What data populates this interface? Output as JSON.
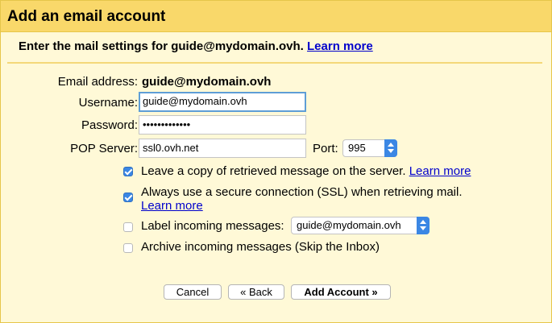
{
  "dialog": {
    "title": "Add an email account",
    "subtitle": "Enter the mail settings for guide@mydomain.ovh.",
    "subtitle_link": "Learn more"
  },
  "form": {
    "email_label": "Email address:",
    "email_value": "guide@mydomain.ovh",
    "username_label": "Username:",
    "username_value": "guide@mydomain.ovh",
    "password_label": "Password:",
    "password_value": "•••••••••••••",
    "pop_label": "POP Server:",
    "pop_value": "ssl0.ovh.net",
    "port_label": "Port:",
    "port_value": "995"
  },
  "options": {
    "leave_copy": {
      "label": "Leave a copy of retrieved message on the server.",
      "link": "Learn more",
      "checked": true
    },
    "ssl": {
      "label": "Always use a secure connection (SSL) when retrieving mail.",
      "link": "Learn more",
      "checked": true
    },
    "label_incoming": {
      "label": "Label incoming messages:",
      "select_value": "guide@mydomain.ovh",
      "checked": false
    },
    "archive": {
      "label": "Archive incoming messages (Skip the Inbox)",
      "checked": false
    }
  },
  "buttons": {
    "cancel": "Cancel",
    "back": "« Back",
    "add_account": "Add Account »"
  },
  "colors": {
    "title_bar": "#f9d86a",
    "panel": "#fff9d7",
    "link": "#0000cc",
    "checkbox": "#3b87e4"
  }
}
